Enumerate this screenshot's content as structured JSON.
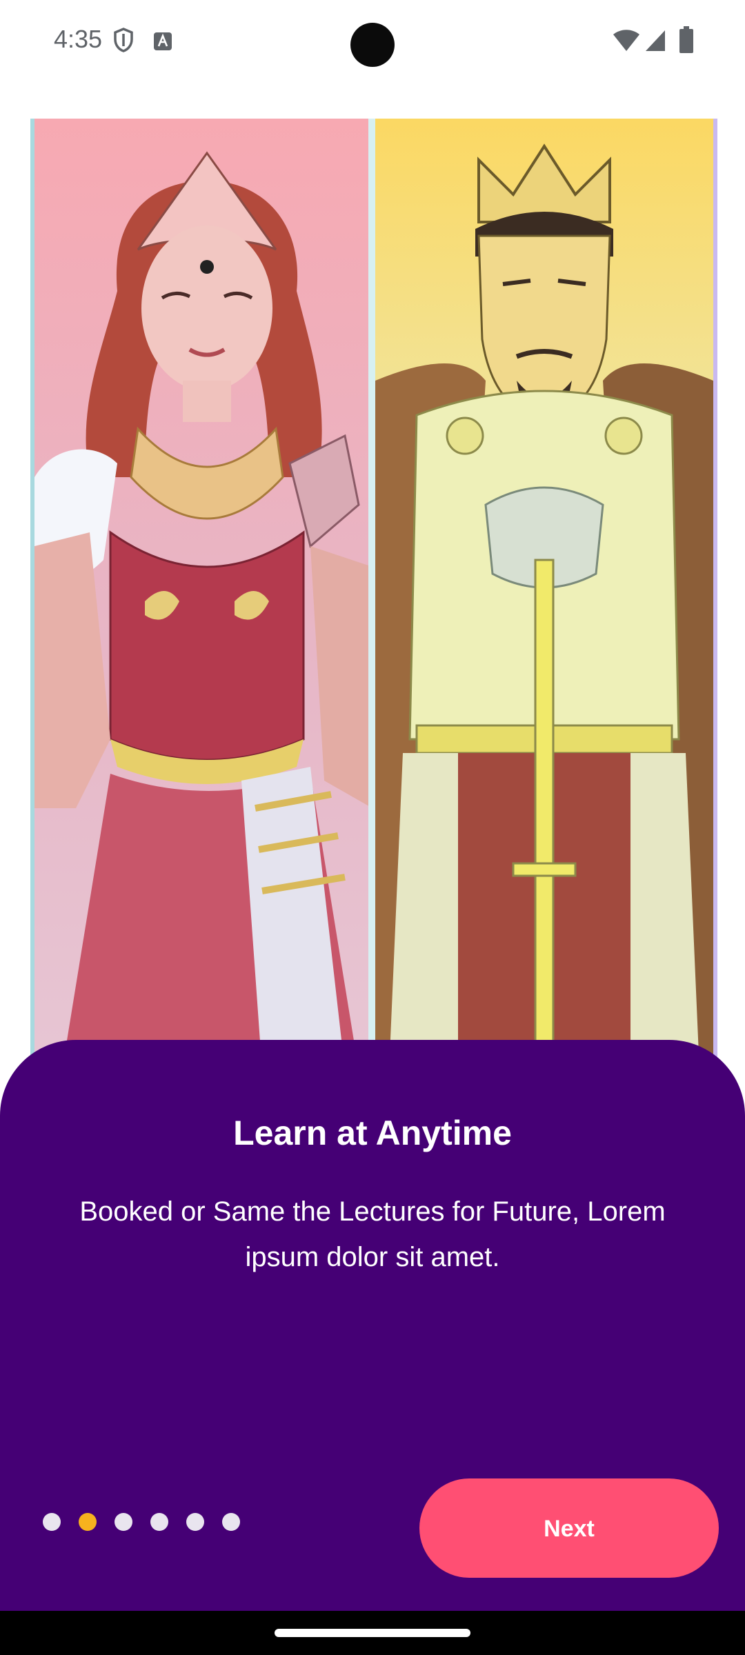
{
  "status_bar": {
    "time": "4:35",
    "icons": [
      "shield-icon",
      "text-a-icon",
      "wifi-icon",
      "signal-icon",
      "battery-icon"
    ]
  },
  "illustration": {
    "left_character": "warrior-queen-illustration",
    "right_character": "king-with-sword-illustration"
  },
  "onboarding": {
    "title": "Learn at Anytime",
    "description": "Booked or Same the Lectures for Future, Lorem ipsum dolor sit amet.",
    "page_count": 6,
    "active_page_index": 1,
    "next_label": "Next"
  },
  "colors": {
    "sheet_background": "#450075",
    "next_button": "#ff4f73",
    "active_dot": "#f7b21e",
    "inactive_dot": "#e9e5ef"
  }
}
